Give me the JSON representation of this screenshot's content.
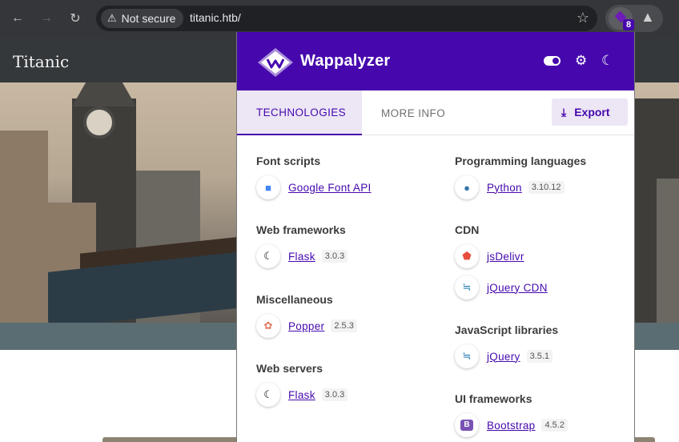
{
  "browser": {
    "security_label": "Not secure",
    "url": "titanic.htb/",
    "extension_badge": "8",
    "icons": [
      "back-icon",
      "forward-icon",
      "reload-icon",
      "warning-icon",
      "star-icon",
      "wappalyzer-icon",
      "puzzle-icon"
    ]
  },
  "site": {
    "title": "Titanic"
  },
  "popup": {
    "brand": "Wappalyzer",
    "tabs": {
      "technologies": "TECHNOLOGIES",
      "more_info": "MORE INFO"
    },
    "export_label": "Export",
    "left_column": [
      {
        "category": "Font scripts",
        "techs": [
          {
            "name": "Google Font API",
            "version": "",
            "icon": "google-fonts-icon"
          }
        ]
      },
      {
        "category": "Web frameworks",
        "techs": [
          {
            "name": "Flask",
            "version": "3.0.3",
            "icon": "flask-icon"
          }
        ]
      },
      {
        "category": "Miscellaneous",
        "techs": [
          {
            "name": "Popper",
            "version": "2.5.3",
            "icon": "popper-icon"
          }
        ]
      },
      {
        "category": "Web servers",
        "techs": [
          {
            "name": "Flask",
            "version": "3.0.3",
            "icon": "flask-icon"
          }
        ]
      }
    ],
    "right_column": [
      {
        "category": "Programming languages",
        "techs": [
          {
            "name": "Python",
            "version": "3.10.12",
            "icon": "python-icon"
          }
        ]
      },
      {
        "category": "CDN",
        "techs": [
          {
            "name": "jsDelivr",
            "version": "",
            "icon": "jsdelivr-icon"
          },
          {
            "name": "jQuery CDN",
            "version": "",
            "icon": "jquery-icon"
          }
        ]
      },
      {
        "category": "JavaScript libraries",
        "techs": [
          {
            "name": "jQuery",
            "version": "3.5.1",
            "icon": "jquery-icon"
          }
        ]
      },
      {
        "category": "UI frameworks",
        "techs": [
          {
            "name": "Bootstrap",
            "version": "4.5.2",
            "icon": "bootstrap-icon"
          }
        ]
      }
    ]
  },
  "colors": {
    "accent": "#4608ad",
    "accent_light": "#ece6f5",
    "chrome": "#35363a",
    "site_header": "#34383b"
  }
}
